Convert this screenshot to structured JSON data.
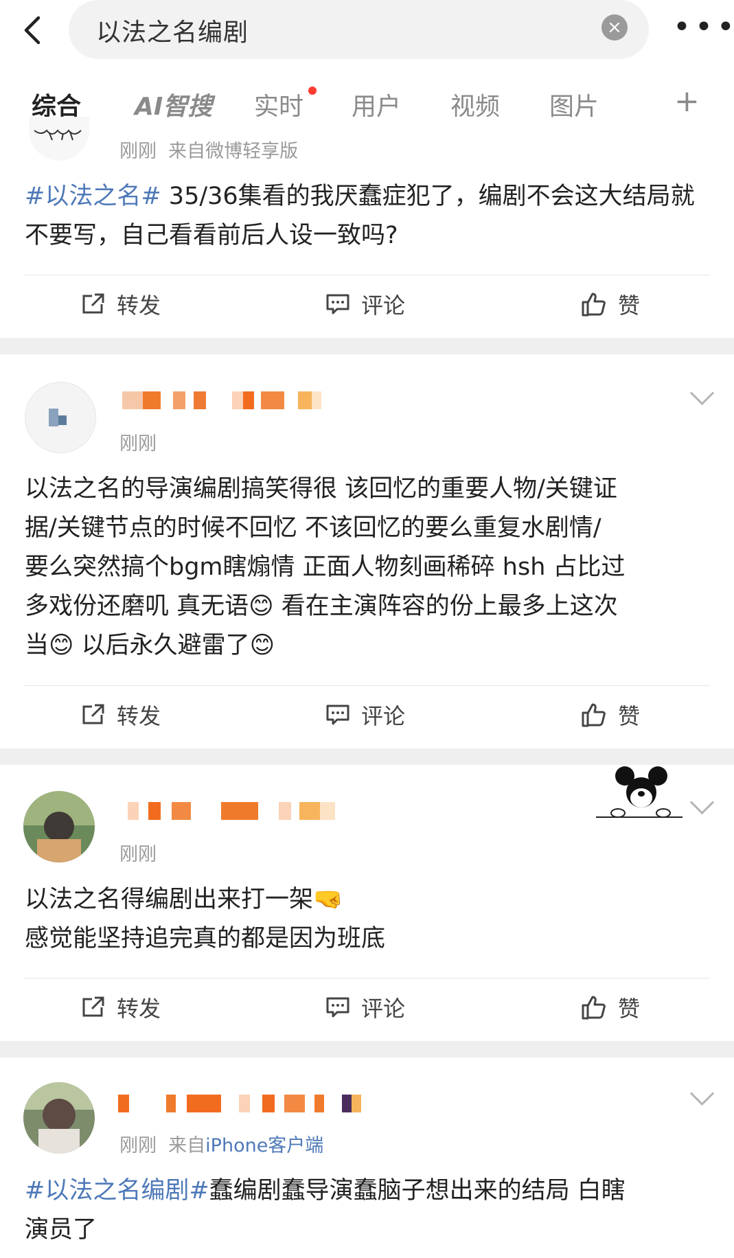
{
  "search": {
    "query": "以法之名编剧"
  },
  "tabs": [
    {
      "label": "综合"
    },
    {
      "label": "AI智搜"
    },
    {
      "label": "实时"
    },
    {
      "label": "用户"
    },
    {
      "label": "视频"
    },
    {
      "label": "图片"
    }
  ],
  "actions": {
    "repost": "转发",
    "comment": "评论",
    "like": "赞"
  },
  "posts": [
    {
      "time": "刚刚",
      "source": "来自微博轻享版",
      "topic": "#以法之名#",
      "text": "35/36集看的我厌蠢症犯了，编剧不会这大结局就不要写，自己看看前后人设一致吗?"
    },
    {
      "time": "刚刚",
      "text_lines": [
        "以法之名的导演编剧搞笑得很 该回忆的重要人物/关键证",
        "据/关键节点的时候不回忆 不该回忆的要么重复水剧情/",
        "要么突然搞个bgm瞎煽情 正面人物刻画稀碎 hsh 占比过",
        "多戏份还磨叽 真无语",
        "看在主演阵容的份上最多上这次",
        "当",
        "以后永久避雷了"
      ]
    },
    {
      "time": "刚刚",
      "text_lines": [
        "以法之名得编剧出来打一架",
        "感觉能坚持追完真的都是因为班底"
      ]
    },
    {
      "time": "刚刚",
      "source_prefix": "来自",
      "source_link": "iPhone客户端",
      "topic": "#以法之名编剧#",
      "text_lines": [
        "蠢编剧蠢导演蠢脑子想出来的结局 白瞎",
        "演员了"
      ]
    }
  ],
  "colors": {
    "accent": "#f39c12",
    "link": "#4e79b8",
    "badge": "#ff3b30"
  }
}
